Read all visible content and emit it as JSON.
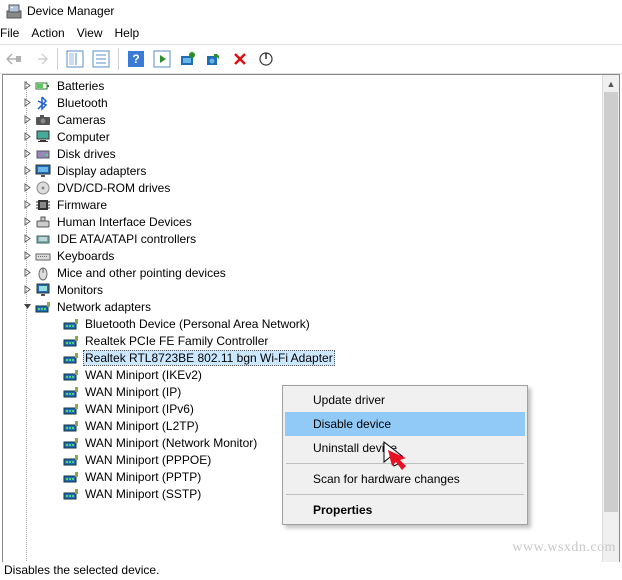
{
  "window": {
    "title": "Device Manager"
  },
  "menu": {
    "file": "File",
    "action": "Action",
    "view": "View",
    "help": "Help"
  },
  "categories": [
    {
      "name": "Batteries",
      "icon": "battery"
    },
    {
      "name": "Bluetooth",
      "icon": "bluetooth"
    },
    {
      "name": "Cameras",
      "icon": "camera"
    },
    {
      "name": "Computer",
      "icon": "computer"
    },
    {
      "name": "Disk drives",
      "icon": "disk"
    },
    {
      "name": "Display adapters",
      "icon": "display"
    },
    {
      "name": "DVD/CD-ROM drives",
      "icon": "dvd"
    },
    {
      "name": "Firmware",
      "icon": "firmware"
    },
    {
      "name": "Human Interface Devices",
      "icon": "hid"
    },
    {
      "name": "IDE ATA/ATAPI controllers",
      "icon": "ide"
    },
    {
      "name": "Keyboards",
      "icon": "keyboard"
    },
    {
      "name": "Mice and other pointing devices",
      "icon": "mouse"
    },
    {
      "name": "Monitors",
      "icon": "monitor"
    }
  ],
  "network": {
    "category": "Network adapters",
    "devices": [
      "Bluetooth Device (Personal Area Network)",
      "Realtek PCIe FE Family Controller",
      "Realtek RTL8723BE 802.11 bgn Wi-Fi Adapter",
      "WAN Miniport (IKEv2)",
      "WAN Miniport (IP)",
      "WAN Miniport (IPv6)",
      "WAN Miniport (L2TP)",
      "WAN Miniport (Network Monitor)",
      "WAN Miniport (PPPOE)",
      "WAN Miniport (PPTP)",
      "WAN Miniport (SSTP)"
    ],
    "selected_index": 2
  },
  "context_menu": {
    "items": [
      "Update driver",
      "Disable device",
      "Uninstall device",
      "Scan for hardware changes",
      "Properties"
    ],
    "hover_index": 1,
    "bold_index": 4
  },
  "status": "Disables the selected device.",
  "watermark": "www.wsxdn.com"
}
